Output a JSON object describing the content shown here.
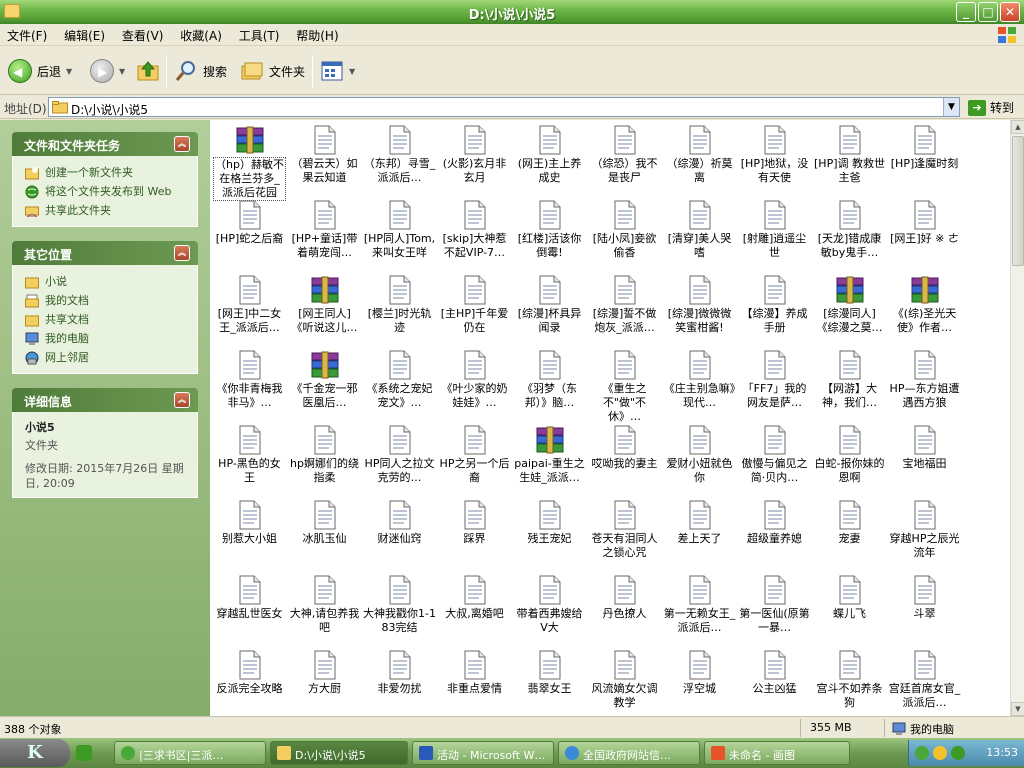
{
  "window": {
    "title": "D:\\小说\\小说5"
  },
  "menu": [
    "文件(F)",
    "编辑(E)",
    "查看(V)",
    "收藏(A)",
    "工具(T)",
    "帮助(H)"
  ],
  "toolbar": {
    "back": "后退",
    "search": "搜索",
    "folders": "文件夹"
  },
  "address": {
    "label": "地址(D)",
    "value": "D:\\小说\\小说5",
    "go": "转到"
  },
  "tasks_panel": {
    "title": "文件和文件夹任务",
    "items": [
      "创建一个新文件夹",
      "将这个文件夹发布到 Web",
      "共享此文件夹"
    ]
  },
  "places_panel": {
    "title": "其它位置",
    "items": [
      "小说",
      "我的文档",
      "共享文档",
      "我的电脑",
      "网上邻居"
    ]
  },
  "details_panel": {
    "title": "详细信息",
    "name": "小说5",
    "type": "文件夹",
    "modified": "修改日期: 2015年7月26日 星期日, 20:09"
  },
  "files": [
    {
      "label": "（hp）赫敏不在格兰芬多_派派后花园",
      "type": "rar"
    },
    {
      "label": "（碧云天）如果云知道",
      "type": "txt"
    },
    {
      "label": "（东邦）寻雪_派派后…",
      "type": "txt"
    },
    {
      "label": "(火影)玄月非玄月",
      "type": "txt"
    },
    {
      "label": "(网王)主上养成史",
      "type": "txt"
    },
    {
      "label": "（综恐）我不是丧尸",
      "type": "txt"
    },
    {
      "label": "（综漫）祈莫离",
      "type": "txt"
    },
    {
      "label": "[HP]地狱，没有天使",
      "type": "txt"
    },
    {
      "label": "[HP]调 教救世主爸",
      "type": "txt"
    },
    {
      "label": "[HP]逢魔时刻",
      "type": "txt"
    },
    {
      "label": "[HP]蛇之后裔",
      "type": "txt"
    },
    {
      "label": "[HP+童话]带着萌宠闯…",
      "type": "txt"
    },
    {
      "label": "[HP同人]Tom,来叫女王咩",
      "type": "txt"
    },
    {
      "label": "[skip]大神惹不起VIP-7…",
      "type": "txt"
    },
    {
      "label": "[红楼]活该你倒霉!",
      "type": "txt"
    },
    {
      "label": "[陆小凤]妾欲偷香",
      "type": "txt"
    },
    {
      "label": "[清穿]美人哭嗜",
      "type": "txt"
    },
    {
      "label": "[射雕]逍遥尘世",
      "type": "txt"
    },
    {
      "label": "[天龙]错成康敏by鬼手…",
      "type": "txt"
    },
    {
      "label": "[网王]好 ※ ㄜ",
      "type": "txt"
    },
    {
      "label": "[网王]中二女王_派派后…",
      "type": "txt"
    },
    {
      "label": "[网王同人]《听说这儿…",
      "type": "rar"
    },
    {
      "label": "[樱兰]时光轨迹",
      "type": "txt"
    },
    {
      "label": "[主HP]千年爱仍在",
      "type": "txt"
    },
    {
      "label": "[综漫]杯具异闻录",
      "type": "txt"
    },
    {
      "label": "[综漫]誓不做炮灰_派派…",
      "type": "txt"
    },
    {
      "label": "[综漫]微微微笑蜜柑酱!",
      "type": "txt"
    },
    {
      "label": "【综漫】养成手册",
      "type": "txt"
    },
    {
      "label": "[综漫同人]《综漫之莫…",
      "type": "rar"
    },
    {
      "label": "《(综)圣光天使》作者…",
      "type": "rar"
    },
    {
      "label": "《你非青梅我非马》…",
      "type": "txt"
    },
    {
      "label": "《千金宠一邪医凰后…",
      "type": "rar"
    },
    {
      "label": "《系统之宠妃宠文》…",
      "type": "txt"
    },
    {
      "label": "《叶少家的奶娃娃》…",
      "type": "txt"
    },
    {
      "label": "《羽梦（东邦）》脑…",
      "type": "txt"
    },
    {
      "label": "《重生之不\"做\"不休》…",
      "type": "txt"
    },
    {
      "label": "《庄主别急嘛》现代…",
      "type": "txt"
    },
    {
      "label": "「FF7」我的网友是萨…",
      "type": "txt"
    },
    {
      "label": "【网游】大神，我们…",
      "type": "txt"
    },
    {
      "label": "HP—东方姐遭遇西方狼",
      "type": "txt"
    },
    {
      "label": "HP-黑色的女王",
      "type": "txt"
    },
    {
      "label": "hp婀娜们的绕指柔",
      "type": "txt"
    },
    {
      "label": "HP同人之拉文克劳的…",
      "type": "txt"
    },
    {
      "label": "HP之另一个后裔",
      "type": "txt"
    },
    {
      "label": "paipai-重生之生娃_派派…",
      "type": "rar"
    },
    {
      "label": "哎呦我的妻主",
      "type": "txt"
    },
    {
      "label": "爱财小妞就色你",
      "type": "txt"
    },
    {
      "label": "傲慢与偏见之简·贝内…",
      "type": "txt"
    },
    {
      "label": "白蛇-报你妹的恩啊",
      "type": "txt"
    },
    {
      "label": "宝地福田",
      "type": "txt"
    },
    {
      "label": "别惹大小姐",
      "type": "txt"
    },
    {
      "label": "冰肌玉仙",
      "type": "txt"
    },
    {
      "label": "财迷仙窍",
      "type": "txt"
    },
    {
      "label": "踩界",
      "type": "txt"
    },
    {
      "label": "残王宠妃",
      "type": "txt"
    },
    {
      "label": "苍天有泪同人之锁心咒",
      "type": "txt"
    },
    {
      "label": "差上天了",
      "type": "txt"
    },
    {
      "label": "超级童养媳",
      "type": "txt"
    },
    {
      "label": "宠妻",
      "type": "txt"
    },
    {
      "label": "穿越HP之辰光流年",
      "type": "txt"
    },
    {
      "label": "穿越乱世医女",
      "type": "txt"
    },
    {
      "label": "大神,请包养我吧",
      "type": "txt"
    },
    {
      "label": "大神我戳你1-183完结",
      "type": "txt"
    },
    {
      "label": "大叔,离婚吧",
      "type": "txt"
    },
    {
      "label": "带着西弗嫂给V大",
      "type": "txt"
    },
    {
      "label": "丹色撩人",
      "type": "txt"
    },
    {
      "label": "第一无赖女王_派派后…",
      "type": "txt"
    },
    {
      "label": "第一医仙(原第一暴…",
      "type": "txt"
    },
    {
      "label": "蝶儿飞",
      "type": "txt"
    },
    {
      "label": "斗翠",
      "type": "txt"
    },
    {
      "label": "反派完全攻略",
      "type": "txt"
    },
    {
      "label": "方大厨",
      "type": "txt"
    },
    {
      "label": "非爱勿扰",
      "type": "txt"
    },
    {
      "label": "非重点爱情",
      "type": "txt"
    },
    {
      "label": "翡翠女王",
      "type": "txt"
    },
    {
      "label": "风流嫡女欠调教学",
      "type": "txt"
    },
    {
      "label": "浮空城",
      "type": "txt"
    },
    {
      "label": "公主凶猛",
      "type": "txt"
    },
    {
      "label": "宫斗不如养条狗",
      "type": "txt"
    },
    {
      "label": "宫廷首席女官_派派后…",
      "type": "txt"
    }
  ],
  "status": {
    "count": "388 个对象",
    "size": "355 MB",
    "location": "我的电脑"
  },
  "taskbar": {
    "start": "K",
    "tasks": [
      "|三求书区|三派…",
      "D:\\小说\\小说5",
      "活动 - Microsoft W…",
      "全国政府网站信…",
      "未命名 - 画图"
    ],
    "clock": "13:53"
  }
}
